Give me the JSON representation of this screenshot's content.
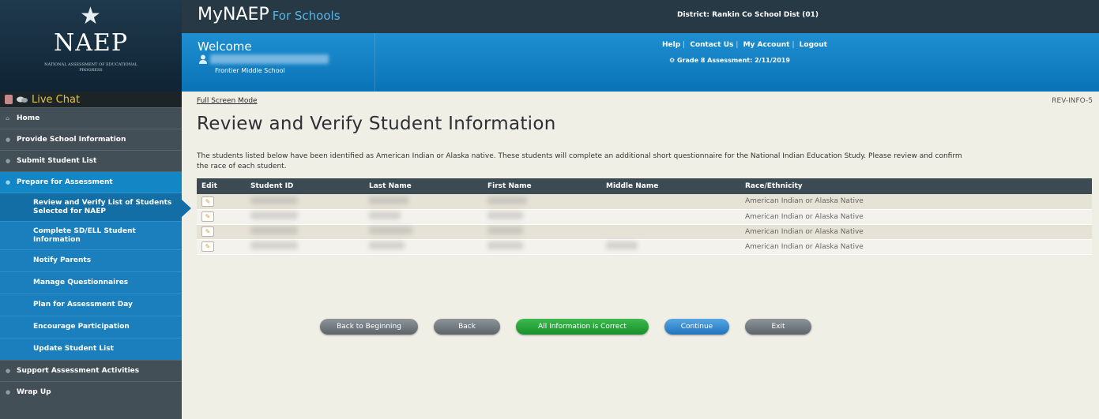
{
  "header": {
    "logo_text": "NAEP",
    "logo_sub": "National Assessment of Educational Progress",
    "brand": "MyNAEP",
    "brand_suffix": "For Schools",
    "district": "District: Rankin Co School Dist (01)",
    "welcome": "Welcome",
    "school": "Frontier Middle School",
    "links": [
      "Help",
      "Contact Us",
      "My Account",
      "Logout"
    ],
    "assessment": "Grade 8 Assessment: 2/11/2019"
  },
  "sidebar": {
    "live_chat": "Live Chat",
    "home": "Home",
    "provide_school": "Provide School Information",
    "submit_list": "Submit Student List",
    "prepare": "Prepare for Assessment",
    "sub": [
      "Review and Verify List of Students Selected for NAEP",
      "Complete SD/ELL Student Information",
      "Notify Parents",
      "Manage Questionnaires",
      "Plan for Assessment Day",
      "Encourage Participation",
      "Update Student List"
    ],
    "support": "Support Assessment Activities",
    "wrap_up": "Wrap Up"
  },
  "main": {
    "full_screen": "Full Screen Mode",
    "screen_code": "REV-INFO-5",
    "title": "Review and Verify Student Information",
    "intro": "The students listed below have been identified as American Indian or Alaska native. These students will complete an additional short questionnaire for the National Indian Education Study. Please review and confirm the race of each student.",
    "columns": [
      "Edit",
      "Student ID",
      "Last Name",
      "First Name",
      "Middle Name",
      "Race/Ethnicity"
    ],
    "rows": [
      {
        "race": "American Indian or Alaska Native"
      },
      {
        "race": "American Indian or Alaska Native"
      },
      {
        "race": "American Indian or Alaska Native"
      },
      {
        "race": "American Indian or Alaska Native"
      }
    ],
    "buttons": {
      "back_to_beginning": "Back to Beginning",
      "back": "Back",
      "all_correct": "All Information is Correct",
      "continue": "Continue",
      "exit": "Exit"
    }
  },
  "colors": {
    "accent_blue": "#1386c6",
    "header_dark": "#263944",
    "sidebar_bg": "#434f57",
    "live_chat": "#e8c43c",
    "confirm_green": "#2aa43b"
  }
}
